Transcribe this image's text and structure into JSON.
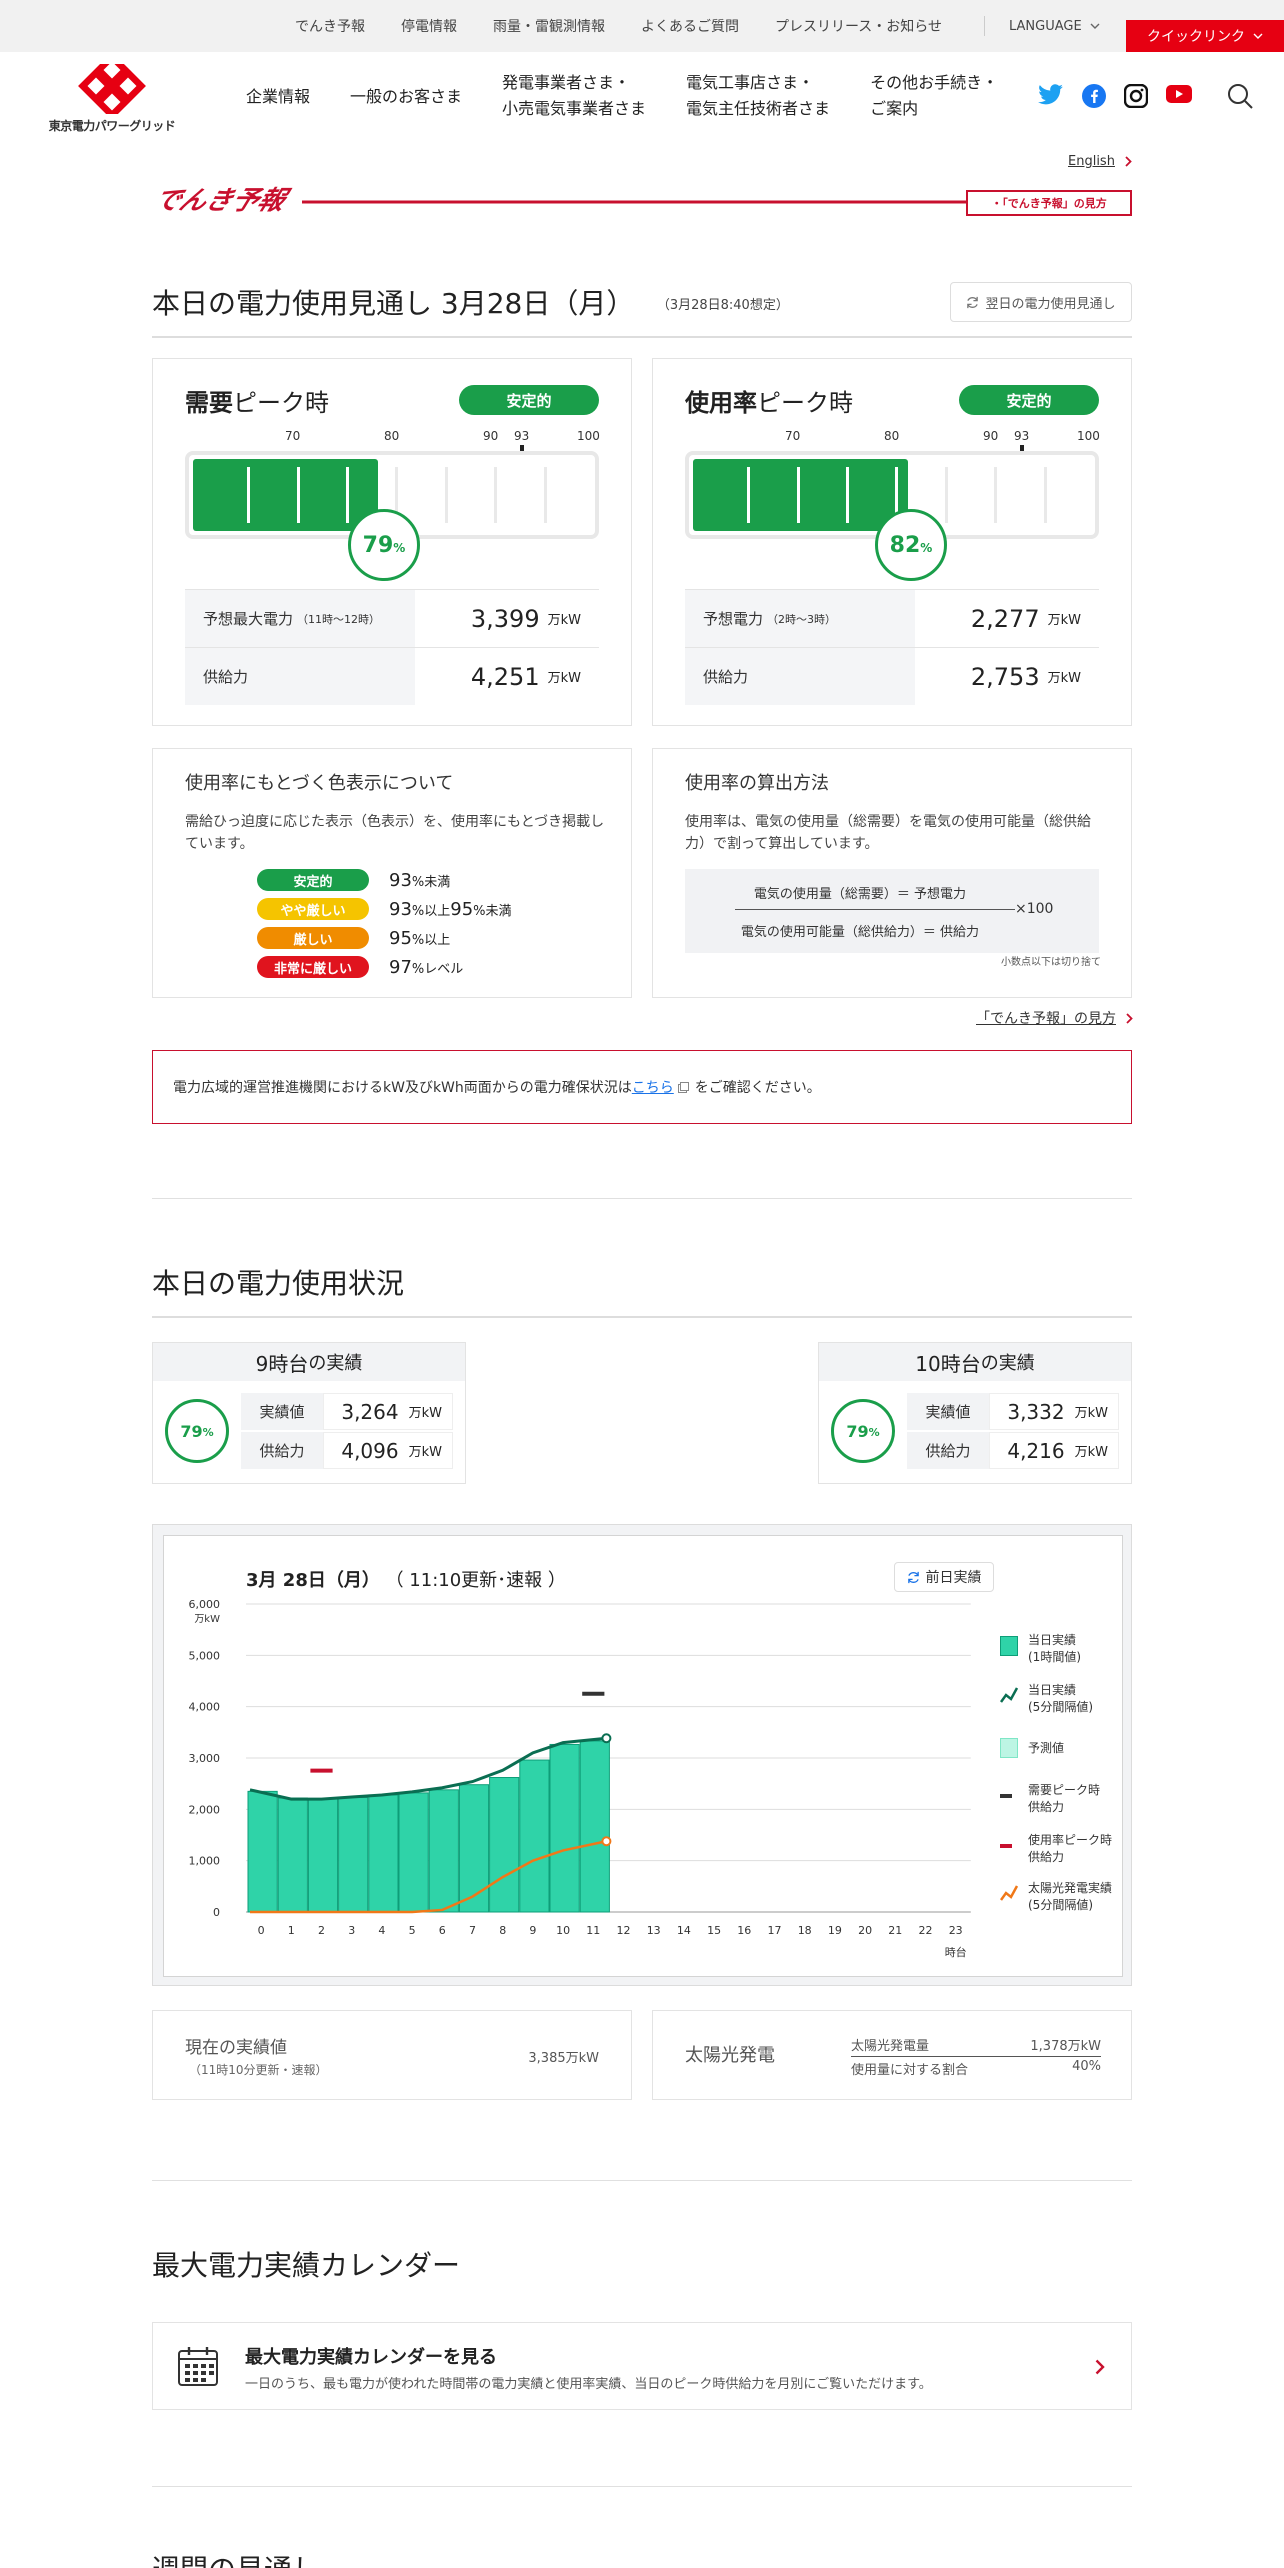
{
  "utility": {
    "links": [
      "でんき予報",
      "停電情報",
      "雨量・雷観測情報",
      "よくあるご質問",
      "プレスリリース・お知らせ"
    ],
    "language": "LANGUAGE",
    "quicklink": "クイックリンク"
  },
  "brand": {
    "name": "東京電力パワーグリッド",
    "color": "#e60012"
  },
  "gnav": [
    "企業情報",
    "一般のお客さま",
    "発電事業者さま・\n小売電気事業者さま",
    "電気工事店さま・\n電気主任技術者さま",
    "その他お手続き・\nご案内"
  ],
  "social": [
    "twitter-icon",
    "facebook-icon",
    "instagram-icon",
    "youtube-icon",
    "search-icon"
  ],
  "english_link": "English",
  "denki_yoho_logo": "でんき予報",
  "mikata_link": "・「でんき予報」の見方",
  "forecast": {
    "title": "本日の電力使用見通し 3月28日（月）",
    "note": "（3月28日8:40想定）",
    "next_day_button": "翌日の電力使用見通し",
    "demand": {
      "title_bold": "需要",
      "title_rest": "ピーク時",
      "status": "安定的",
      "percent": 79,
      "pct_unit": "%",
      "rows": [
        {
          "label": "予想最大電力",
          "note": "（11時～12時）",
          "value": "3,399",
          "unit": "万kW"
        },
        {
          "label": "供給力",
          "note": "",
          "value": "4,251",
          "unit": "万kW"
        }
      ]
    },
    "usage": {
      "title_bold": "使用率",
      "title_rest": "ピーク時",
      "status": "安定的",
      "percent": 82,
      "pct_unit": "%",
      "rows": [
        {
          "label": "予想電力",
          "note": "（2時～3時）",
          "value": "2,277",
          "unit": "万kW"
        },
        {
          "label": "供給力",
          "note": "",
          "value": "2,753",
          "unit": "万kW"
        }
      ]
    },
    "scale_labels": [
      "70",
      "80",
      "90",
      "93",
      "100"
    ],
    "green": "#1a9e4a"
  },
  "color_info": {
    "title": "使用率にもとづく色表示について",
    "text": "需給ひっ迫度に応じた表示（色表示）を、使用率にもとづき掲載しています。",
    "levels": [
      {
        "label": "安定的",
        "color": "#1a9e4a",
        "v1": "93",
        "u1": "%未満",
        "v2": "",
        "u2": ""
      },
      {
        "label": "やや厳しい",
        "color": "#f5c400",
        "v1": "93",
        "u1": "%以上",
        "v2": "95",
        "u2": "%未満"
      },
      {
        "label": "厳しい",
        "color": "#f08c00",
        "v1": "95",
        "u1": "%以上",
        "v2": "",
        "u2": ""
      },
      {
        "label": "非常に厳しい",
        "color": "#e0141e",
        "v1": "97",
        "u1": "%レベル",
        "v2": "",
        "u2": ""
      }
    ]
  },
  "calc_info": {
    "title": "使用率の算出方法",
    "text": "使用率は、電気の使用量（総需要）を電気の使用可能量（総供給力）で割って算出しています。",
    "numerator": "電気の使用量（総需要）＝ 予想電力",
    "denominator": "電気の使用可能量（総供給力）＝ 供給力",
    "times": "×100",
    "footnote": "小数点以下は切り捨て"
  },
  "mikata_link2": "「でんき予報」の見方",
  "notice": {
    "before": "電力広域的運営推進機関におけるkW及びkWh両面からの電力確保状況は",
    "link": "こちら",
    "after": "をご確認ください。"
  },
  "status": {
    "title": "本日の電力使用状況",
    "hours": [
      {
        "head_num": "9時台",
        "head_rest": "の実績",
        "percent": 79,
        "pct_unit": "%",
        "actual_label": "実績値",
        "actual": "3,264",
        "supply_label": "供給力",
        "supply": "4,096",
        "unit": "万kW"
      },
      {
        "head_num": "10時台",
        "head_rest": "の実績",
        "percent": 79,
        "pct_unit": "%",
        "actual_label": "実績値",
        "actual": "3,332",
        "supply_label": "供給力",
        "supply": "4,216",
        "unit": "万kW"
      }
    ]
  },
  "chart_data": {
    "type": "bar",
    "title_date": "3月 28日（月）",
    "title_note": "（ 11:10更新･速報 ）",
    "prev_button": "前日実績",
    "ylabel_unit": "万kW",
    "xlabel_unit": "時台",
    "ylim": [
      0,
      6000
    ],
    "yticks": [
      "0",
      "1,000",
      "2,000",
      "3,000",
      "4,000",
      "5,000",
      "6,000"
    ],
    "categories": [
      "0",
      "1",
      "2",
      "3",
      "4",
      "5",
      "6",
      "7",
      "8",
      "9",
      "10",
      "11",
      "12",
      "13",
      "14",
      "15",
      "16",
      "17",
      "18",
      "19",
      "20",
      "21",
      "22",
      "23"
    ],
    "series": [
      {
        "name": "当日実績\n(1時間値)",
        "values": [
          2350,
          2220,
          2210,
          2230,
          2280,
          2320,
          2380,
          2480,
          2620,
          2960,
          3264,
          3332
        ]
      },
      {
        "name": "当日実績\n(5分間隔値)",
        "values": [
          2380,
          2200,
          2200,
          2240,
          2280,
          2340,
          2420,
          2540,
          2760,
          3100,
          3300,
          3385
        ]
      },
      {
        "name": "予測値",
        "values": []
      },
      {
        "name": "需要ピーク時\n供給力",
        "values": [
          {
            "x": 11.5,
            "y": 4251
          }
        ]
      },
      {
        "name": "使用率ピーク時\n供給力",
        "values": [
          {
            "x": 2.5,
            "y": 2753
          }
        ]
      },
      {
        "name": "太陽光発電実績\n(5分間隔値)",
        "values": [
          0,
          0,
          0,
          0,
          0,
          0,
          40,
          300,
          680,
          1000,
          1200,
          1378
        ]
      }
    ],
    "colors": {
      "bar": "#2fd3a8",
      "bar_edge": "#0e9e78",
      "line": "#0a6e52",
      "forecast": "#bdf5e4",
      "demand_peak": "#333333",
      "usage_peak": "#c8102e",
      "solar": "#f07818"
    }
  },
  "current": {
    "label": "現在の実績値",
    "note": "（11時10分更新・速報）",
    "value": "3,385万kW"
  },
  "solar": {
    "label": "太陽光発電",
    "amount_label": "太陽光発電量",
    "amount": "1,378万kW",
    "ratio_label": "使用量に対する割合",
    "ratio": "40%"
  },
  "calendar": {
    "section_title": "最大電力実績カレンダー",
    "link_title": "最大電力実績カレンダーを見る",
    "link_text": "一日のうち、最も電力が使われた時間帯の電力実績と使用率実績、当日のピーク時供給力を月別にご覧いただけます。"
  },
  "weekly_title": "週間の見通し"
}
